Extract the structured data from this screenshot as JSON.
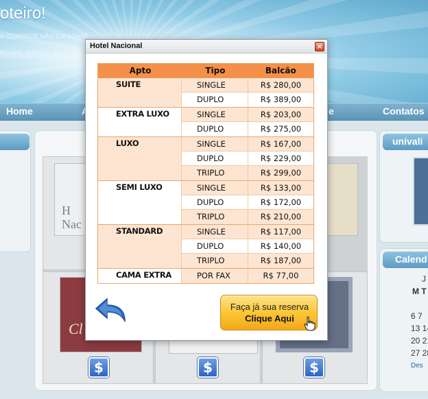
{
  "site": {
    "title": "oteiro!",
    "tagline_1": "A CONSISTE NÃO EM ACHAR NOVAS PAISAGENS",
    "tagline_2": "OLHOS. MARCEL PROUST"
  },
  "nav": {
    "home": "Home",
    "item_a": "A",
    "item_e": "e",
    "contatos": "Contatos"
  },
  "right_widget": {
    "title": "univali"
  },
  "calendar": {
    "title": "Calend",
    "month_letter": "J",
    "day_headers": "M T",
    "row1": "6 7",
    "row2": "13 14",
    "row3": "20 21",
    "row4": "27 28",
    "prev_link": "Des"
  },
  "thumbnails": {
    "hotel_nacional_text": "H\nNac",
    "clarion_text": "Cl"
  },
  "dollar_symbol": "$",
  "dialog": {
    "title": "Hotel Nacional",
    "close_symbol": "×",
    "table": {
      "headers": {
        "apto": "Apto",
        "tipo": "Tipo",
        "balcao": "Balcão"
      },
      "groups": [
        {
          "apto": "SUITE",
          "rows": [
            {
              "tipo": "SINGLE",
              "valor": "R$ 280,00"
            },
            {
              "tipo": "DUPLO",
              "valor": "R$ 389,00"
            }
          ]
        },
        {
          "apto": "EXTRA LUXO",
          "rows": [
            {
              "tipo": "SINGLE",
              "valor": "R$ 203,00"
            },
            {
              "tipo": "DUPLO",
              "valor": "R$ 275,00"
            }
          ]
        },
        {
          "apto": "LUXO",
          "rows": [
            {
              "tipo": "SINGLE",
              "valor": "R$ 167,00"
            },
            {
              "tipo": "DUPLO",
              "valor": "R$ 229,00"
            },
            {
              "tipo": "TRIPLO",
              "valor": "R$ 299,00"
            }
          ]
        },
        {
          "apto": "SEMI LUXO",
          "rows": [
            {
              "tipo": "SINGLE",
              "valor": "R$ 133,00"
            },
            {
              "tipo": "DUPLO",
              "valor": "R$ 172,00"
            },
            {
              "tipo": "TRIPLO",
              "valor": "R$ 210,00"
            }
          ]
        },
        {
          "apto": "STANDARD",
          "rows": [
            {
              "tipo": "SINGLE",
              "valor": "R$ 117,00"
            },
            {
              "tipo": "DUPLO",
              "valor": "R$ 140,00"
            },
            {
              "tipo": "TRIPLO",
              "valor": "R$ 187,00"
            }
          ]
        },
        {
          "apto": "CAMA EXTRA",
          "rows": [
            {
              "tipo": "POR FAX",
              "valor": "R$ 77,00"
            }
          ]
        }
      ]
    },
    "reserve_button": {
      "line1": "Faça já sua reserva",
      "line2": "Clique Aqui"
    },
    "icons": {
      "back": "back-arrow-icon",
      "cursor": "hand-pointer-icon"
    }
  },
  "colors": {
    "table_header": "#f4904a",
    "table_row_shade": "#fde5d2",
    "button_gold": "#fbc736",
    "nav_bar": "#6ea5c6"
  }
}
